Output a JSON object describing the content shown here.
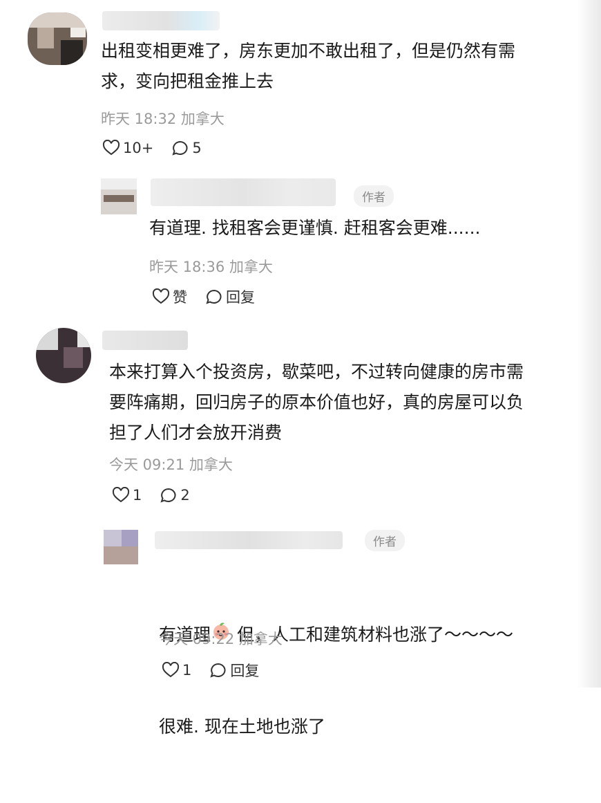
{
  "comments": [
    {
      "text": "出租变相更难了，房东更加不敢出租了，但是仍然有需\n求，变向把租金推上去",
      "time": "昨天 18:32",
      "location": "加拿大",
      "likes": "10+",
      "replies": "5"
    },
    {
      "author_tag": "作者",
      "text": "有道理. 找租客会更谨慎. 赶租客会更难......",
      "time": "昨天 18:36",
      "location": "加拿大",
      "like_label": "赞",
      "reply_label": "回复"
    },
    {
      "text": "本来打算入个投资房，歇菜吧，不过转向健康的房市需\n要阵痛期，回归房子的原本价值也好，真的房屋可以负\n担了人们才会放开消费",
      "time": "今天 09:21",
      "location": "加拿大",
      "likes": "1",
      "replies": "2"
    },
    {
      "author_tag": "作者",
      "text_before_emoji": "有道理",
      "text_after_emoji": " 但，人工和建筑材料也涨了～～～～",
      "text_line2": "很难. 现在土地也涨了",
      "time": "今天 09:22",
      "location": "加拿大",
      "likes": "1",
      "reply_label": "回复"
    }
  ],
  "icons": {
    "like": "heart-outline-icon",
    "reply": "speech-bubble-icon",
    "emoji": "peach-face-emoji"
  },
  "colors": {
    "text": "#1a1a1a",
    "meta": "#9a9a9a",
    "author_tag_bg": "#f2f2f2"
  }
}
